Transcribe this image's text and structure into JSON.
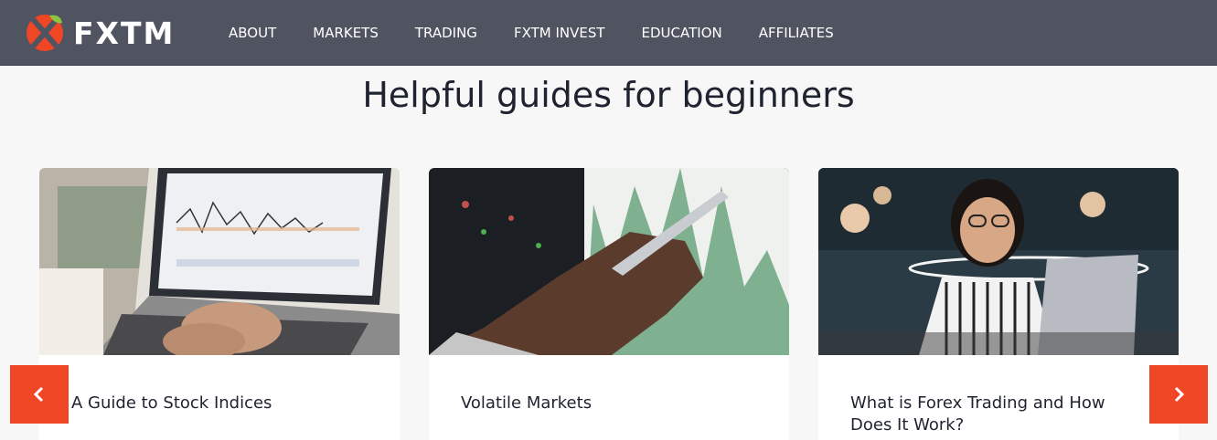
{
  "brand": {
    "name": "FXTM",
    "accent": "#ef4626",
    "header_bg": "#505461"
  },
  "nav": {
    "items": [
      "ABOUT",
      "MARKETS",
      "TRADING",
      "FXTM INVEST",
      "EDUCATION",
      "AFFILIATES"
    ]
  },
  "section": {
    "title": "Helpful guides for beginners"
  },
  "cards": [
    {
      "title": "A Guide to Stock Indices",
      "image_icon": "laptop-chart-image"
    },
    {
      "title": "Volatile Markets",
      "image_icon": "hand-pen-chart-image"
    },
    {
      "title": "What is Forex Trading and How Does It Work?",
      "image_icon": "woman-laptop-image"
    }
  ],
  "carousel": {
    "prev_icon": "chevron-left-icon",
    "next_icon": "chevron-right-icon"
  }
}
